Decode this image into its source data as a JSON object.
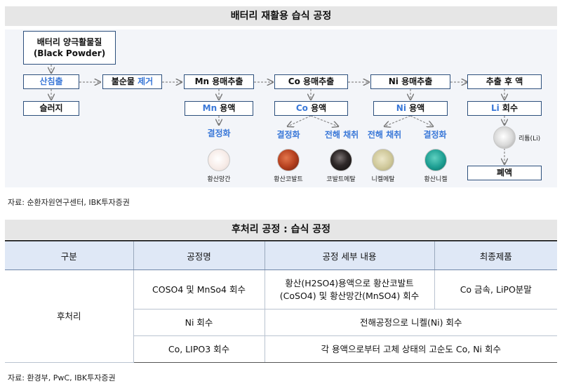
{
  "top": {
    "title": "배터리 재활용 습식 공정",
    "source": "자료: 순환자원연구센터, IBK투자증권",
    "start_box": {
      "line1": "배터리 양극활물질",
      "line2": "(Black Powder)"
    },
    "leach": {
      "label": "산침출",
      "residue": "슬러지"
    },
    "impurity": {
      "prefix": "불순물 ",
      "suffix": "제거"
    },
    "mn": {
      "step": "Mn 용매추출",
      "sol_el": "Mn",
      "sol_rest": " 용액",
      "branch": "결정화",
      "product": "황산망간"
    },
    "co": {
      "step": "Co 용매추출",
      "sol_el": "Co",
      "sol_rest": " 용액",
      "branch1": "결정화",
      "branch2": "전해 채취",
      "product1": "황산코발트",
      "product2": "코발트메탈"
    },
    "ni": {
      "step": "Ni 용매추출",
      "sol_el": "Ni",
      "sol_rest": " 용액",
      "branch1": "전해 채취",
      "branch2": "결정화",
      "product1": "니켈메탈",
      "product2": "황산니켈"
    },
    "final": {
      "step": "추출 후 액",
      "sol_el": "Li",
      "sol_rest": " 회수",
      "product": "리튬(Li)",
      "waste": "폐액"
    },
    "colors": {
      "box_border": "#2c4f7c",
      "accent_blue": "#3a78d8",
      "header_bg": "#e6e6e6",
      "flow_bg": "#f3f5f9"
    }
  },
  "bottom": {
    "title": "후처리 공정 : 습식 공정",
    "source": "자료: 환경부, PwC, IBK투자증권",
    "headers": [
      "구분",
      "공정명",
      "공정 세부 내용",
      "최종제품"
    ],
    "category": "후처리",
    "rows": [
      {
        "name": "COSO4 및 MnSo4 회수",
        "detail1": "황산(H2SO4)용액으로 황산코발트",
        "detail2": "(CoSO4) 및 황산망간(MnSO4) 회수",
        "product": "Co 금속, LiPO분말"
      },
      {
        "name": "Ni 회수",
        "detail": "전해공정으로 니켈(Ni) 회수"
      },
      {
        "name": "Co, LIPO3 회수",
        "detail": "각 용액으로부터 고체 상태의 고순도 Co, Ni 회수"
      }
    ],
    "colors": {
      "table_header_bg": "#dfe8f6"
    }
  }
}
